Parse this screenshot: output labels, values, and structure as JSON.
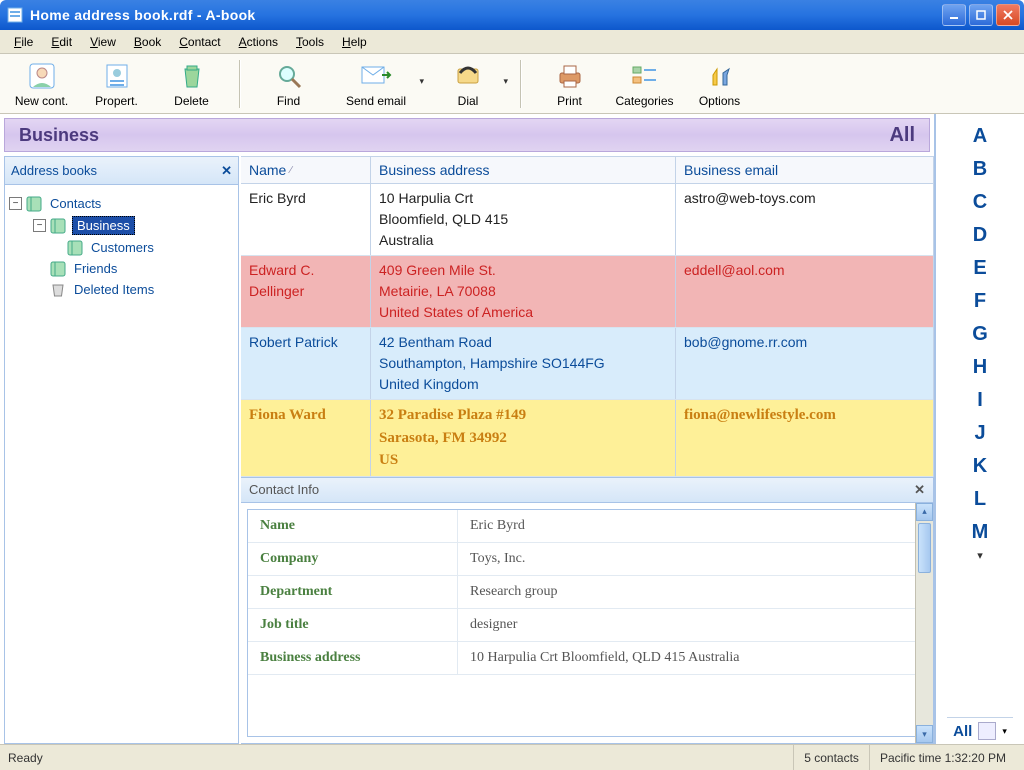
{
  "window": {
    "title": "Home address book.rdf - A-book"
  },
  "menubar": {
    "items": [
      "File",
      "Edit",
      "View",
      "Book",
      "Contact",
      "Actions",
      "Tools",
      "Help"
    ]
  },
  "toolbar": {
    "items": [
      {
        "name": "new-contact",
        "label": "New cont."
      },
      {
        "name": "properties",
        "label": "Propert."
      },
      {
        "name": "delete",
        "label": "Delete"
      },
      {
        "name": "find",
        "label": "Find"
      },
      {
        "name": "send-email",
        "label": "Send email"
      },
      {
        "name": "dial",
        "label": "Dial"
      },
      {
        "name": "print",
        "label": "Print"
      },
      {
        "name": "categories",
        "label": "Categories"
      },
      {
        "name": "options",
        "label": "Options"
      }
    ]
  },
  "category_header": {
    "title": "Business",
    "filter": "All"
  },
  "sidebar": {
    "title": "Address books",
    "nodes": {
      "root": "Contacts",
      "business": "Business",
      "customers": "Customers",
      "friends": "Friends",
      "deleted": "Deleted Items"
    }
  },
  "table": {
    "columns": {
      "name": "Name",
      "addr": "Business address",
      "email": "Business email"
    },
    "rows": [
      {
        "name": "Eric Byrd",
        "addr1": "10 Harpulia Crt",
        "addr2": "Bloomfield, QLD 415",
        "addr3": "Australia",
        "email": "astro@web-toys.com"
      },
      {
        "name": "Edward C. Dellinger",
        "addr1": "409 Green Mile St.",
        "addr2": "Metairie, LA 70088",
        "addr3": "United States of America",
        "email": "eddell@aol.com"
      },
      {
        "name": "Robert Patrick",
        "addr1": "42 Bentham Road",
        "addr2": "Southampton, Hampshire SO144FG",
        "addr3": "United Kingdom",
        "email": "bob@gnome.rr.com"
      },
      {
        "name": "Fiona Ward",
        "addr1": "32 Paradise Plaza #149",
        "addr2": "Sarasota, FM 34992",
        "addr3": "US",
        "email": "fiona@newlifestyle.com"
      }
    ]
  },
  "contact_info": {
    "title": "Contact Info",
    "fields": [
      {
        "label": "Name",
        "value": "Eric Byrd"
      },
      {
        "label": "Company",
        "value": "Toys, Inc."
      },
      {
        "label": "Department",
        "value": "Research group"
      },
      {
        "label": "Job title",
        "value": "designer"
      },
      {
        "label": "Business address",
        "value": "10 Harpulia Crt Bloomfield, QLD 415 Australia"
      }
    ]
  },
  "alphabet": [
    "A",
    "B",
    "C",
    "D",
    "E",
    "F",
    "G",
    "H",
    "I",
    "J",
    "K",
    "L",
    "M"
  ],
  "alpha_footer": {
    "label": "All"
  },
  "statusbar": {
    "left": "Ready",
    "count": "5 contacts",
    "time": "Pacific time 1:32:20 PM"
  }
}
